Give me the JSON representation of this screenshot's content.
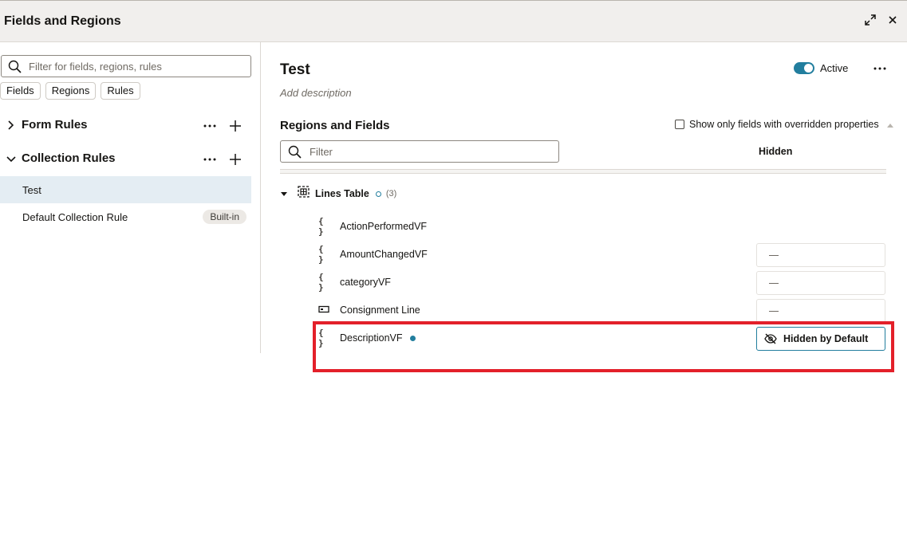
{
  "window": {
    "title": "Fields and Regions",
    "maximize_icon": "expand-icon",
    "close_icon": "close-icon"
  },
  "left_panel": {
    "search": {
      "placeholder": "Filter for fields, regions, rules",
      "value": ""
    },
    "filter_chips": [
      "Fields",
      "Regions",
      "Rules"
    ],
    "sections": [
      {
        "label": "Form Rules",
        "expanded": false
      },
      {
        "label": "Collection Rules",
        "expanded": true
      }
    ],
    "collection_rules": [
      {
        "label": "Test",
        "selected": true,
        "badge": ""
      },
      {
        "label": "Default Collection Rule",
        "selected": false,
        "badge": "Built-in"
      }
    ]
  },
  "right_panel": {
    "title": "Test",
    "description_placeholder": "Add description",
    "active_label": "Active",
    "active": true,
    "section_title": "Regions and Fields",
    "override_checkbox_label": "Show only fields with overridden properties",
    "override_checked": false,
    "filter_placeholder": "Filter",
    "column_header": "Hidden",
    "group": {
      "label": "Lines Table",
      "count": "(3)",
      "expanded": true
    },
    "fields": [
      {
        "label": "ActionPerformedVF",
        "icon": "{ }",
        "hidden_value": ""
      },
      {
        "label": "AmountChangedVF",
        "icon": "{ }",
        "hidden_value": "—"
      },
      {
        "label": "categoryVF",
        "icon": "{ }",
        "hidden_value": "—"
      },
      {
        "label": "Consignment Line",
        "icon": "input-field-icon",
        "hidden_value": "—"
      },
      {
        "label": "DescriptionVF",
        "icon": "{ }",
        "hidden_value": "Hidden by Default",
        "modified": true
      }
    ]
  },
  "colors": {
    "accent": "#227e9e",
    "selected_bg": "#e4edf3",
    "highlight": "#e3202a",
    "titlebar_bg": "#f1efed"
  }
}
